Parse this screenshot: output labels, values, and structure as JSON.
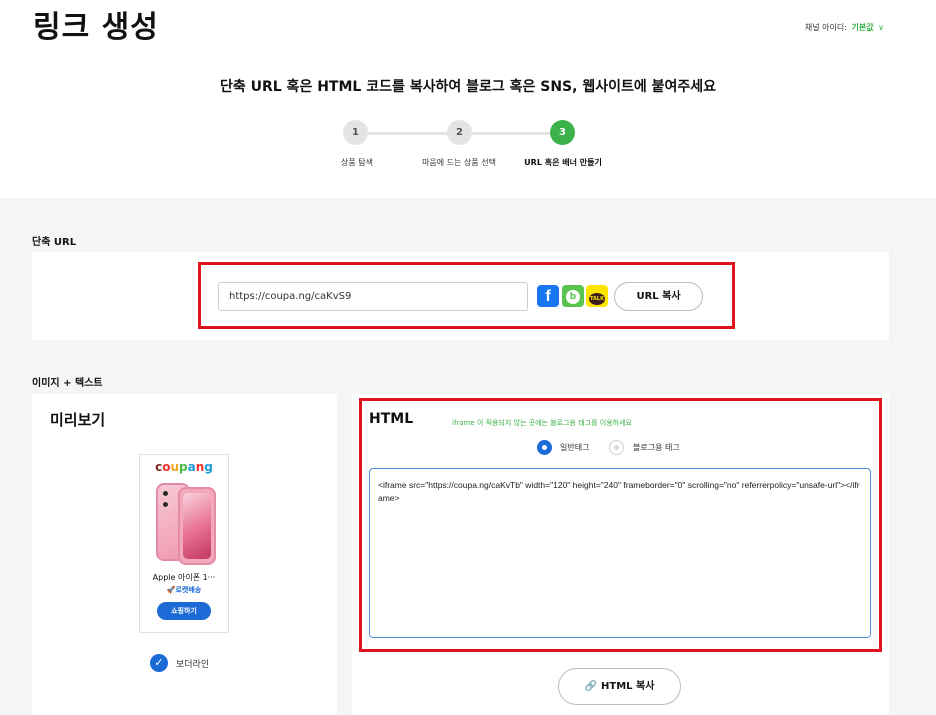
{
  "page": {
    "title": "링크 생성",
    "channel_label": "채널 아이디:",
    "channel_value": "기본값",
    "channel_chevron": "∨",
    "subtitle": "단축 URL 혹은 HTML 코드를 복사하여 블로그 혹은 SNS, 웹사이트에 붙여주세요"
  },
  "steps": [
    {
      "number": "1",
      "label": "상품 탐색",
      "active": false
    },
    {
      "number": "2",
      "label": "마음에 드는 상품 선택",
      "active": false
    },
    {
      "number": "3",
      "label": "URL 혹은 배너 만들기",
      "active": true
    }
  ],
  "short_url": {
    "section_label": "단축 URL",
    "url_value": "https://coupa.ng/caKvS9",
    "share_icons": [
      {
        "name": "facebook-icon",
        "glyph": "f"
      },
      {
        "name": "band-icon",
        "glyph": "b"
      },
      {
        "name": "kakaotalk-icon",
        "glyph": "TALK"
      }
    ],
    "copy_button": "URL 복사"
  },
  "image_text": {
    "section_label": "이미지 + 텍스트",
    "preview": {
      "title": "미리보기",
      "banner_brand": [
        "c",
        "o",
        "u",
        "p",
        "a",
        "n",
        "g"
      ],
      "product_name": "Apple 아이폰 1···",
      "rocket_label": "🚀로켓배송",
      "shop_button": "쇼핑하기",
      "border_option": "보더라인",
      "border_checked": true
    },
    "html": {
      "title": "HTML",
      "note": "iframe 이 적용되지 않는 곳에는 블로그용 태그를 이용하세요",
      "radio_options": [
        {
          "label": "일반태그",
          "selected": true
        },
        {
          "label": "블로그용 태그",
          "selected": false
        }
      ],
      "code": "<iframe src=\"https://coupa.ng/caKvTb\" width=\"120\" height=\"240\" frameborder=\"0\" scrolling=\"no\" referrerpolicy=\"unsafe-url\"></iframe>",
      "copy_button": "HTML 복사"
    }
  },
  "colors": {
    "accent_green": "#3bb24a",
    "accent_blue": "#1b6ad6",
    "highlight_red": "#e0141e"
  }
}
